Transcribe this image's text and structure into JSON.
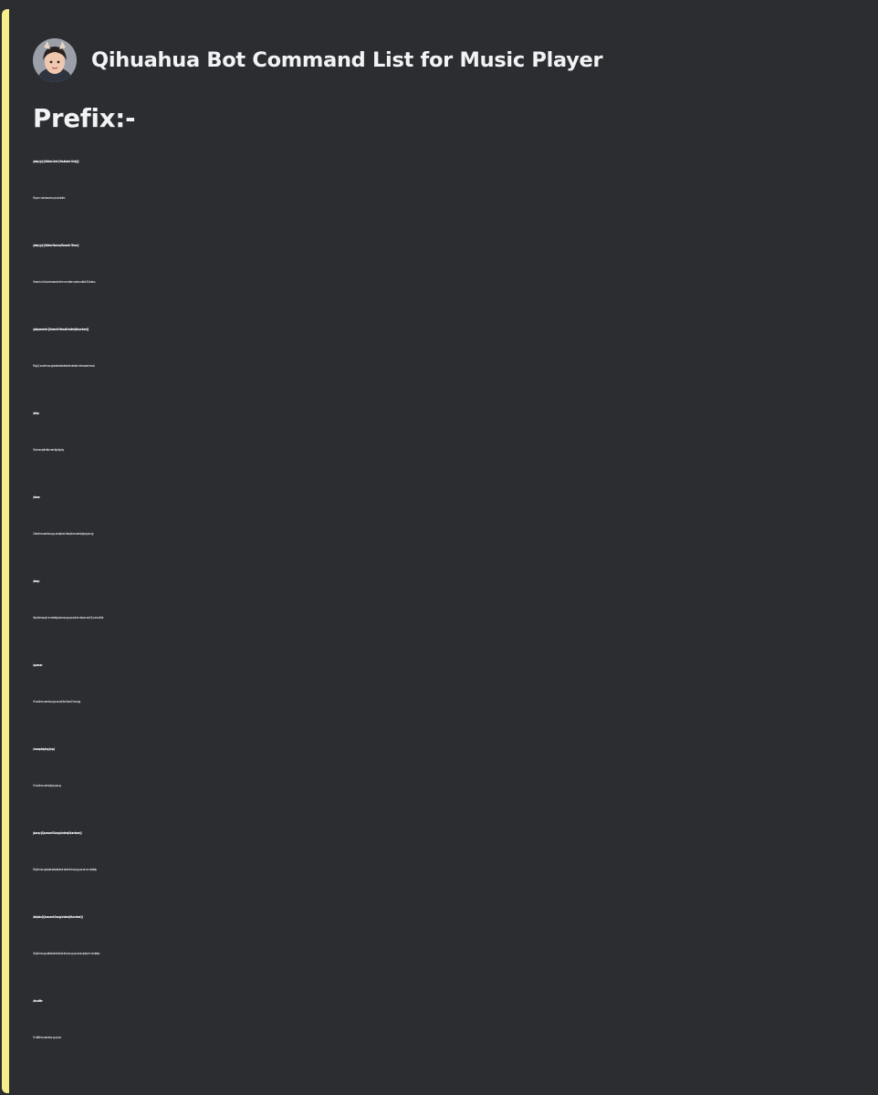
{
  "embed": {
    "accent_color": "#f5ef8a",
    "background_color": "#2b2d31",
    "author": {
      "avatar_icon": "avatar-icon",
      "name": "Qihuahua Bot Command List for Music Player"
    },
    "prefix": "Prefix:-",
    "commands": [
      {
        "name": "/play (p) [Video Link (Youtube Only)]",
        "description": "Play a music based on youtube link."
      },
      {
        "name": "/play (p) [Video Name/Search Term]",
        "description": "Search on Youtube based on the name/term, return a list of 10 videos."
      },
      {
        "name": "/playsearch [Search Result Index(Number)]",
        "description": "Play/Queue the song located at selected index from the search result."
      },
      {
        "name": "/skip",
        "description": "Skip a song that is currently playing."
      },
      {
        "name": "/clear",
        "description": "Clear the current song queue.(It won't stop the current playing song)"
      },
      {
        "name": "/stop",
        "description": "Stop the song immediately, clear song queue, then disconnect Qihuahua Bot"
      },
      {
        "name": "/queue",
        "description": "Show the current song queue.(Max View: 15 songs)"
      },
      {
        "name": "/nowplaying (np)",
        "description": "Show the current playing song."
      },
      {
        "name": "/jump [Queued Song Index(Number)]",
        "description": "Play the song located at selected index in the song queue immediately."
      },
      {
        "name": "/skipto [Queued Song Index(Number)]",
        "description": "Skip the song until selected index in the song queue and play immediately."
      },
      {
        "name": "/shuffle",
        "description": "Shuffle the current song queue."
      }
    ]
  }
}
